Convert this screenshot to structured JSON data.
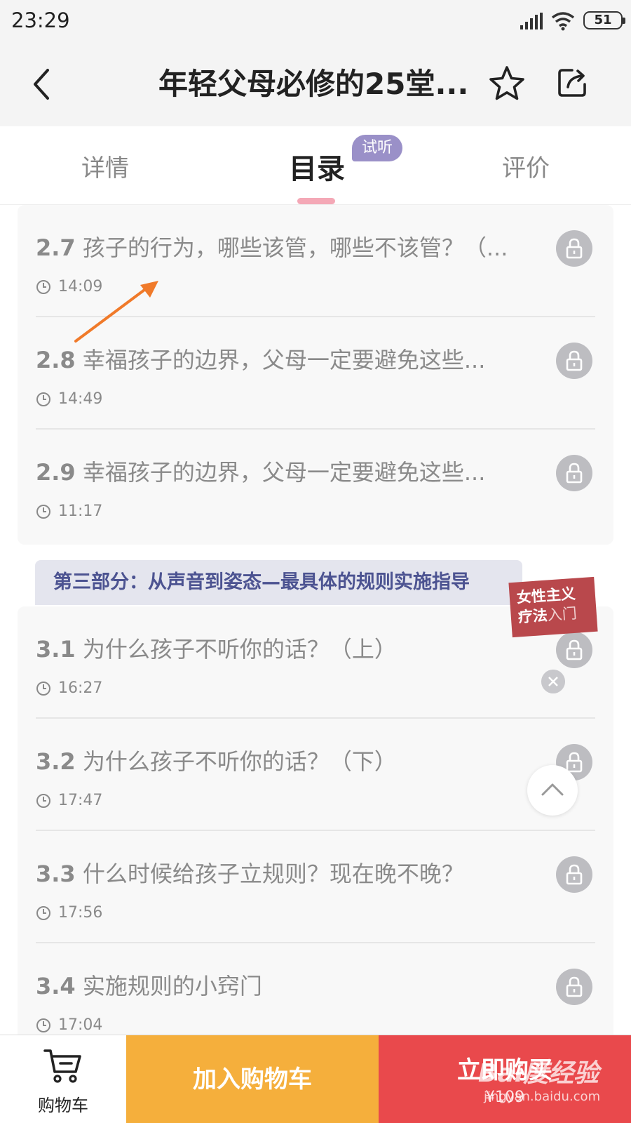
{
  "status_bar": {
    "time": "23:29",
    "battery": "51"
  },
  "header": {
    "title": "年轻父母必修的25堂..."
  },
  "tabs": {
    "details": "详情",
    "catalog": "目录",
    "reviews": "评价",
    "trial_badge": "试听"
  },
  "section_one_items": [
    {
      "num": "2.7",
      "title": "孩子的行为，哪些该管，哪些不该管？（...",
      "duration": "14:09"
    },
    {
      "num": "2.8",
      "title": "幸福孩子的边界，父母一定要避免这些...",
      "duration": "14:49"
    },
    {
      "num": "2.9",
      "title": "幸福孩子的边界，父母一定要避免这些...",
      "duration": "11:17"
    }
  ],
  "section_three": {
    "header": "第三部分：从声音到姿态—最具体的规则实施指导",
    "items": [
      {
        "num": "3.1",
        "title": "为什么孩子不听你的话？（上）",
        "duration": "16:27"
      },
      {
        "num": "3.2",
        "title": "为什么孩子不听你的话？（下）",
        "duration": "17:47"
      },
      {
        "num": "3.3",
        "title": "什么时候给孩子立规则？现在晚不晚？",
        "duration": "17:56"
      },
      {
        "num": "3.4",
        "title": "实施规则的小窍门",
        "duration": "17:04"
      }
    ]
  },
  "sticker": {
    "line1": "女性主义",
    "line2a": "疗法",
    "line2b": "入门"
  },
  "bottom_bar": {
    "cart_label": "购物车",
    "add_to_cart": "加入购物车",
    "buy_now": "立即购买",
    "price": "¥109"
  },
  "watermark": {
    "brand": "Bai度经验",
    "url": "jingyan.baidu.com"
  },
  "colors": {
    "add_cart": "#f5af3c",
    "buy": "#e9494c",
    "section_header_text": "#4c5391",
    "tab_indicator": "#f4a8b6",
    "annotation_arrow": "#f07a2a"
  }
}
